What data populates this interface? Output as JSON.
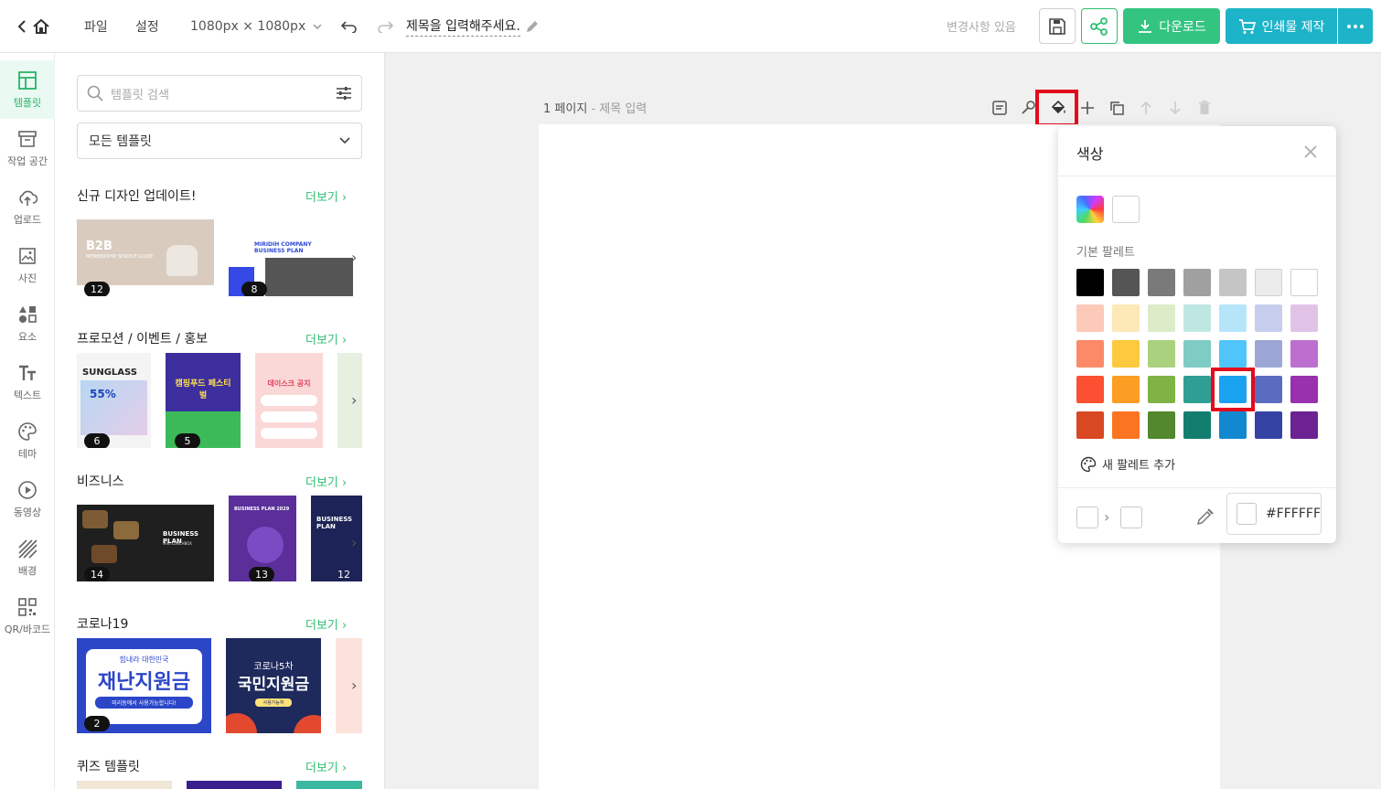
{
  "topbar": {
    "menu_file": "파일",
    "menu_settings": "설정",
    "size": "1080px × 1080px",
    "title": "제목을 입력해주세요.",
    "status": "변경사항 있음",
    "download_label": "다운로드",
    "print_label": "인쇄물 제작"
  },
  "rail": {
    "items": [
      {
        "label": "템플릿",
        "icon": "layout-icon"
      },
      {
        "label": "작업 공간",
        "icon": "archive-icon"
      },
      {
        "label": "업로드",
        "icon": "upload-cloud-icon"
      },
      {
        "label": "사진",
        "icon": "image-icon"
      },
      {
        "label": "요소",
        "icon": "shapes-icon"
      },
      {
        "label": "텍스트",
        "icon": "text-icon"
      },
      {
        "label": "테마",
        "icon": "palette-icon"
      },
      {
        "label": "동영상",
        "icon": "play-icon"
      },
      {
        "label": "배경",
        "icon": "background-icon"
      },
      {
        "label": "QR/바코드",
        "icon": "qr-icon"
      }
    ]
  },
  "panel": {
    "search_placeholder": "템플릿 검색",
    "filter_selected": "모든 템플릿",
    "more_label": "더보기",
    "sections": [
      {
        "title": "신규 디자인 업데이트!",
        "thumbs": [
          {
            "badge": "12",
            "text": "B2B",
            "sub": "MEMBERSHIP SERVICE GUIDE"
          },
          {
            "badge": "8",
            "text": "MIRIDIH COMPANY BUSINESS PLAN"
          }
        ]
      },
      {
        "title": "프로모션 / 이벤트 / 홍보",
        "thumbs": [
          {
            "badge": "6",
            "text": "SUNGLASS",
            "sub": "55%"
          },
          {
            "badge": "5",
            "text": "캠핑푸드 페스티벌"
          },
          {
            "badge": "",
            "text": "데이스크 공지"
          }
        ]
      },
      {
        "title": "비즈니스",
        "thumbs": [
          {
            "badge": "14",
            "text": "BUSINESS PLAN",
            "sub": "MIRI LUNCHBOX"
          },
          {
            "badge": "13",
            "text": "BUSINESS PLAN 2029"
          },
          {
            "badge": "12",
            "text": "BUSINESS PLAN"
          }
        ]
      },
      {
        "title": "코로나19",
        "thumbs": [
          {
            "badge": "2",
            "text": "재난지원금",
            "sub": "미리동에서 사용가능합니다!",
            "top": "힘내라 대한민국"
          },
          {
            "badge": "",
            "text": "국민지원금",
            "sub": "코로나5차",
            "foot": "사용가능처"
          }
        ]
      },
      {
        "title": "퀴즈 템플릿",
        "thumbs": []
      }
    ]
  },
  "canvas": {
    "page_label": "1 페이지",
    "page_sub": "- 제목 입력"
  },
  "color_popup": {
    "title": "색상",
    "palette_label": "기본 팔레트",
    "add_palette": "새 팔레트 추가",
    "hex_value": "#FFFFFF",
    "selected_color": "#1aa3f0",
    "palette": [
      [
        "#000000",
        "#555555",
        "#7a7a7a",
        "#a0a0a0",
        "#c5c5c5",
        "#ececec",
        "#ffffff"
      ],
      [
        "#fdc9b9",
        "#fde9b7",
        "#dcebc8",
        "#bfe7e2",
        "#b6e5fa",
        "#c7cdec",
        "#e1c3e8"
      ],
      [
        "#fc8a68",
        "#fdc93e",
        "#a9d17e",
        "#7eccc4",
        "#50c5fb",
        "#9da7d6",
        "#bc6fcf"
      ],
      [
        "#fb5031",
        "#fc9e24",
        "#7fb345",
        "#2f9f93",
        "#1aa3f0",
        "#5b6cc0",
        "#9930ae"
      ],
      [
        "#d74823",
        "#fb7421",
        "#53882e",
        "#137e70",
        "#1288d0",
        "#3543a5",
        "#6c2293"
      ]
    ]
  }
}
